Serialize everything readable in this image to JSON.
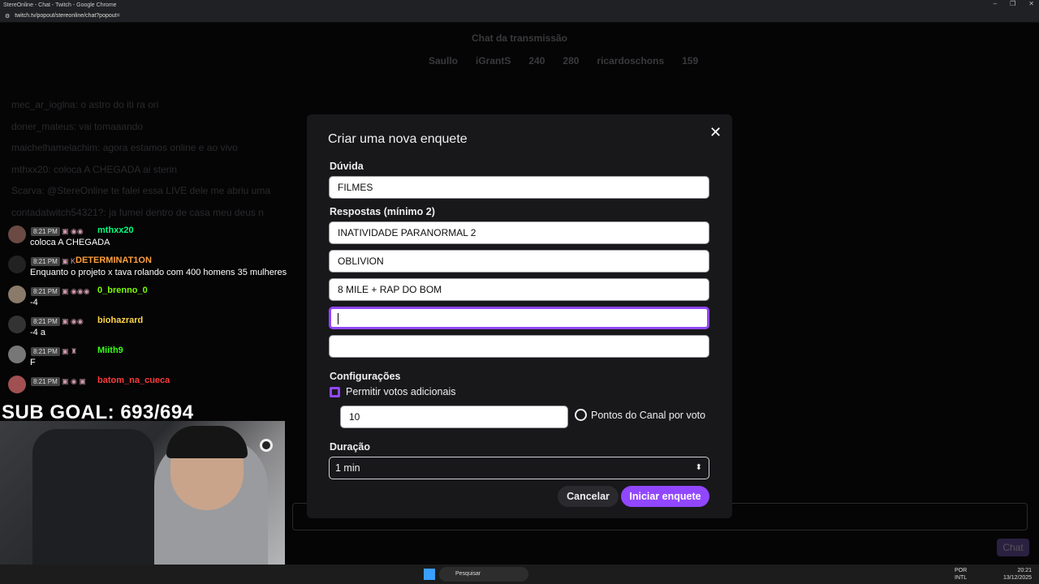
{
  "browser": {
    "window_title": "StereOnline - Chat - Twitch - Google Chrome",
    "url": "twitch.tv/popout/stereonline/chat?popout="
  },
  "chat": {
    "header": "Chat da transmissão",
    "leaderboard": [
      "Saullo",
      "iGrantS",
      "240",
      "280",
      "ricardoschons",
      "159"
    ],
    "background_lines": [
      "mec_ar_ioglna: o astro do iti ra ori",
      "doner_mateus: vai tomaaando",
      "maichelhamelachim: agora estamos online e ao vivo",
      "mthxx20: coloca A CHEGADA ai sterin",
      "Scarva: @StereOnline te falei essa LIVE dele me abriu uma",
      "contadatwitch54321?: ja fumei dentro de casa meu deus n"
    ],
    "messages": [
      {
        "time": "8:21 PM",
        "user": "mthxx20",
        "user_color": "#00ff7f",
        "text": "coloca A CHEGADA"
      },
      {
        "time": "8:21 PM",
        "user": "DETERMINAT1ON",
        "user_color": "#ff9f3a",
        "text": "Enquanto o projeto x tava rolando com 400 homens 35 mulheres"
      },
      {
        "time": "8:21 PM",
        "user": "0_brenno_0",
        "user_color": "#7cfc00",
        "text": "-4"
      },
      {
        "time": "8:21 PM",
        "user": "biohazrard",
        "user_color": "#ffd54a",
        "text": "-4 a"
      },
      {
        "time": "8:21 PM",
        "user": "Miith9",
        "user_color": "#39ff14",
        "text": "F"
      },
      {
        "time": "8:21 PM",
        "user": "batom_na_cueca",
        "user_color": "#ff3b3b",
        "text": ""
      }
    ],
    "send_label": "Chat"
  },
  "overlay": {
    "sub_goal": "SUB GOAL: 693/694"
  },
  "poll_modal": {
    "title": "Criar uma nova enquete",
    "question_label": "Dúvida",
    "question_value": "FILMES",
    "answers_label": "Respostas (mínimo 2)",
    "answers": [
      "INATIVIDADE PARANORMAL 2",
      "OBLIVION",
      "8 MILE + RAP DO BOM",
      "",
      ""
    ],
    "settings_label": "Configurações",
    "allow_extra_votes_label": "Permitir votos adicionais",
    "allow_extra_votes_checked": true,
    "points_value": "10",
    "points_label": "Pontos do Canal por voto",
    "duration_label": "Duração",
    "duration_value": "1 min",
    "cancel_label": "Cancelar",
    "start_label": "Iniciar enquete"
  },
  "taskbar": {
    "search_placeholder": "Pesquisar",
    "lang": "POR",
    "layout": "INTL",
    "time": "20:21",
    "date": "13/12/2025"
  }
}
